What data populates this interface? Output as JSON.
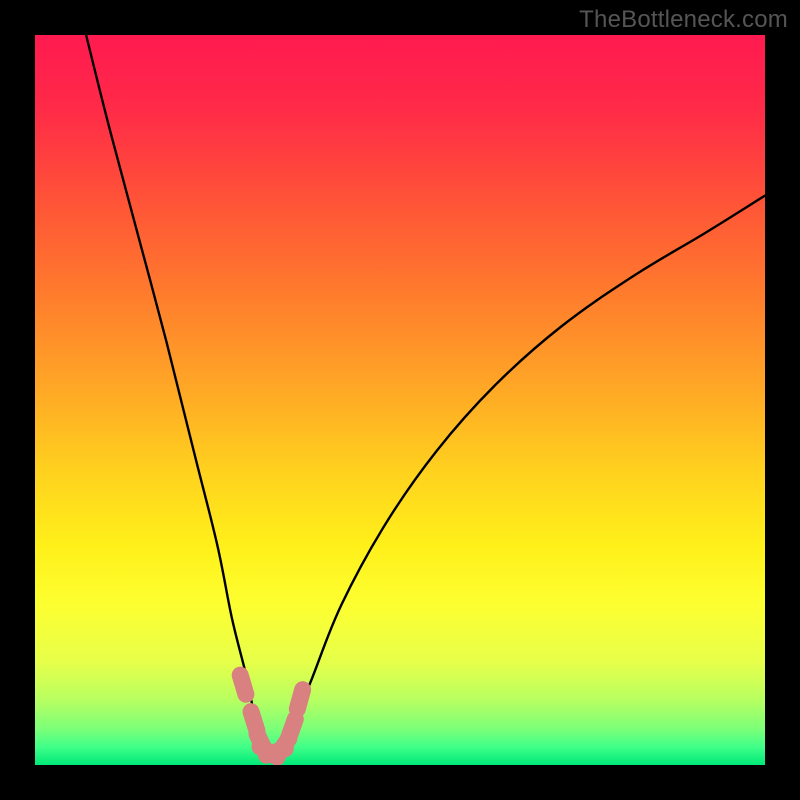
{
  "watermark": {
    "text": "TheBottleneck.com"
  },
  "gradient": {
    "stops": [
      {
        "offset": 0.0,
        "color": "#ff1a50"
      },
      {
        "offset": 0.1,
        "color": "#ff2a48"
      },
      {
        "offset": 0.22,
        "color": "#ff5138"
      },
      {
        "offset": 0.35,
        "color": "#ff7a2d"
      },
      {
        "offset": 0.48,
        "color": "#ffa626"
      },
      {
        "offset": 0.6,
        "color": "#ffd21e"
      },
      {
        "offset": 0.7,
        "color": "#fff01a"
      },
      {
        "offset": 0.78,
        "color": "#fdff30"
      },
      {
        "offset": 0.86,
        "color": "#e6ff4a"
      },
      {
        "offset": 0.91,
        "color": "#b8ff60"
      },
      {
        "offset": 0.95,
        "color": "#7dff78"
      },
      {
        "offset": 0.975,
        "color": "#40ff88"
      },
      {
        "offset": 1.0,
        "color": "#00e878"
      }
    ]
  },
  "chart_data": {
    "type": "line",
    "title": "",
    "xlabel": "",
    "ylabel": "",
    "xlim": [
      0,
      100
    ],
    "ylim": [
      0,
      100
    ],
    "grid": false,
    "note": "Bottleneck-style V curve; y≈100 is worst (red), y≈0 is best (green). Minimum near x≈32.",
    "series": [
      {
        "name": "bottleneck-curve",
        "color": "#000000",
        "x": [
          7,
          10,
          14,
          18,
          22,
          25,
          27,
          29,
          30,
          31,
          32,
          33,
          34,
          35,
          36,
          38,
          42,
          48,
          55,
          63,
          72,
          82,
          92,
          100
        ],
        "y": [
          100,
          88,
          73,
          58,
          42,
          30,
          20,
          12,
          7,
          3,
          1.5,
          1.5,
          2,
          4,
          7,
          12,
          22,
          33,
          43,
          52,
          60,
          67,
          73,
          78
        ]
      }
    ],
    "markers": [
      {
        "name": "near-minimum-nubs",
        "color": "#d98080",
        "shape": "rounded-segment",
        "points_x": [
          28.5,
          30.0,
          31.0,
          32.0,
          33.0,
          34.0,
          35.2,
          36.3
        ],
        "points_y": [
          11,
          6,
          3,
          1.8,
          1.8,
          2.5,
          5,
          9
        ]
      }
    ]
  }
}
